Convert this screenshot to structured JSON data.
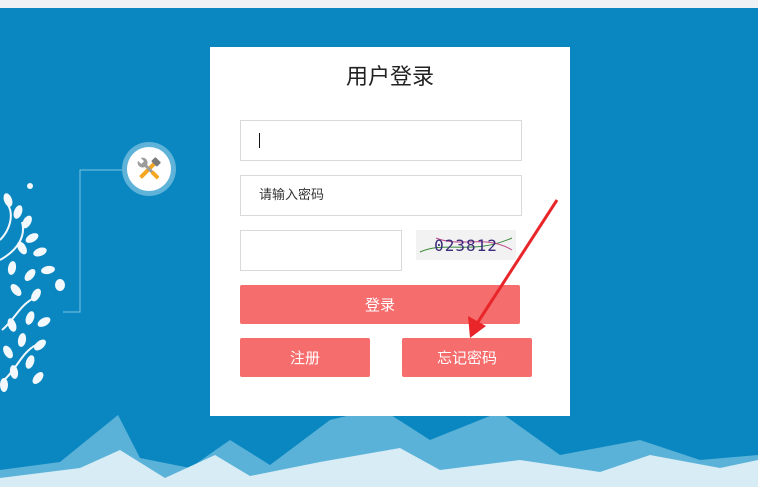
{
  "login": {
    "title": "用户登录",
    "password_placeholder": "请输入密码",
    "captcha_text": "023812",
    "login_label": "登录",
    "register_label": "注册",
    "forgot_label": "忘记密码"
  },
  "colors": {
    "background": "#0a87c1",
    "button": "#f66d6d",
    "arrow": "#e8262a",
    "mountain_light": "#d7ecf5"
  },
  "icons": {
    "badge": "tools-icon",
    "annotation": "red-arrow"
  }
}
